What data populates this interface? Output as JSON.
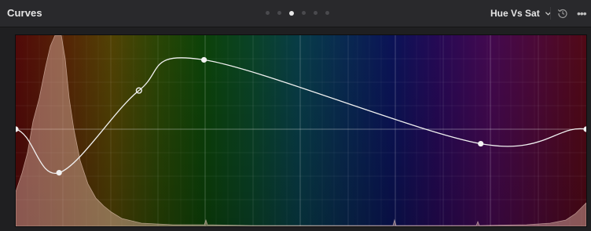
{
  "panel": {
    "title": "Curves",
    "pager": {
      "count": 6,
      "active_index": 2
    },
    "mode_label": "Hue Vs Sat",
    "icons": {
      "mode_dropdown": "chevron-down-icon",
      "reset": "reset-icon",
      "more": "more-options-icon"
    }
  },
  "graph": {
    "control_points": [
      {
        "hue": 0.0,
        "sat_offset": 0.0
      },
      {
        "hue": 0.076,
        "sat_offset": -0.54
      },
      {
        "hue": 0.216,
        "sat_offset": 0.48
      },
      {
        "hue": 0.33,
        "sat_offset": 0.86
      },
      {
        "hue": 0.815,
        "sat_offset": -0.18
      },
      {
        "hue": 1.0,
        "sat_offset": 0.0
      }
    ],
    "colors": {
      "curve": "#f0f0f0",
      "grid": "#ffffff",
      "histogram": "#f2c6b4"
    }
  }
}
